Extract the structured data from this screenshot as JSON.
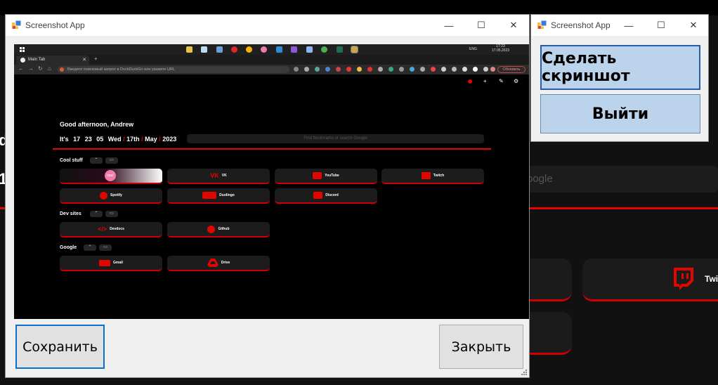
{
  "background_page": {
    "fragments": [
      "d",
      "1",
      "oogle",
      "Twit"
    ]
  },
  "main_window": {
    "title": "Screenshot App",
    "save_label": "Сохранить",
    "close_label": "Закрыть",
    "minimize_glyph": "—",
    "maximize_glyph": "☐",
    "close_glyph": "✕"
  },
  "small_window": {
    "title": "Screenshot App",
    "take_screenshot_label": "Сделать скриншот",
    "exit_label": "Выйти"
  },
  "screenshot": {
    "taskbar": {
      "time": "17:23",
      "date": "17.05.2023",
      "lang": "ENG"
    },
    "tab_title": "Main Tab",
    "address_placeholder": "Введите поисковый запрос в DuckDuckGo или укажите URL",
    "update_button": "Обновить",
    "greeting": "Good afternoon, Andrew",
    "clock": {
      "prefix": "It's",
      "h": "17",
      "m": "23",
      "s": "05",
      "day": "Wed",
      "date": "17th",
      "month": "May",
      "year": "2023"
    },
    "search_placeholder": "Find bookmarks or search Google",
    "sections": [
      {
        "name": "Cool stuff",
        "tiles": [
          "",
          "VK",
          "YouTube",
          "Twitch",
          "Spotify",
          "Duolingo",
          "Discord"
        ]
      },
      {
        "name": "Dev sites",
        "tiles": [
          "Devdocs",
          "Github"
        ]
      },
      {
        "name": "Google",
        "tiles": [
          "Gmail",
          "Drive"
        ]
      }
    ],
    "colors": {
      "accent": "#e10600",
      "tile": "#1c1c1c",
      "bg": "#000000"
    }
  }
}
